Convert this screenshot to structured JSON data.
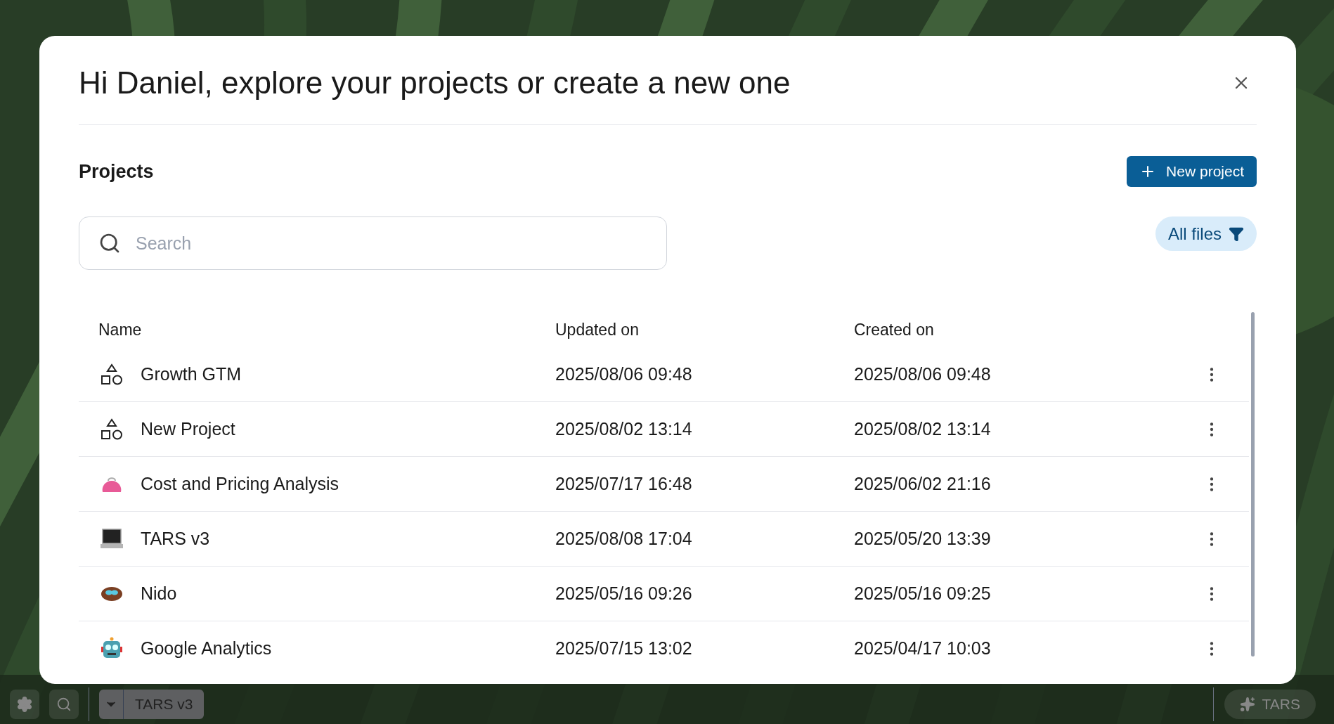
{
  "dialog": {
    "title": "Hi Daniel, explore your projects or create a new one",
    "section_title": "Projects",
    "new_button": "New project",
    "search": {
      "placeholder": "Search"
    },
    "filter_button": "All files"
  },
  "table": {
    "columns": [
      "Name",
      "Updated on",
      "Created on"
    ],
    "rows": [
      {
        "kind": "shapes",
        "name": "Growth GTM",
        "updated": "2025/08/06 09:48",
        "created": "2025/08/06 09:48"
      },
      {
        "kind": "shapes",
        "name": "New Project",
        "updated": "2025/08/02 13:14",
        "created": "2025/08/02 13:14"
      },
      {
        "kind": "purse",
        "name": "Cost and Pricing Analysis",
        "updated": "2025/07/17 16:48",
        "created": "2025/06/02 21:16"
      },
      {
        "kind": "laptop",
        "name": "TARS v3",
        "updated": "2025/08/08 17:04",
        "created": "2025/05/20 13:39"
      },
      {
        "kind": "nest",
        "name": "Nido",
        "updated": "2025/05/16 09:26",
        "created": "2025/05/16 09:25"
      },
      {
        "kind": "robot",
        "name": "Google Analytics",
        "updated": "2025/07/15 13:02",
        "created": "2025/04/17 10:03"
      }
    ]
  },
  "bottom_bar": {
    "project_selector": "TARS v3",
    "assistant_button": "TARS"
  }
}
